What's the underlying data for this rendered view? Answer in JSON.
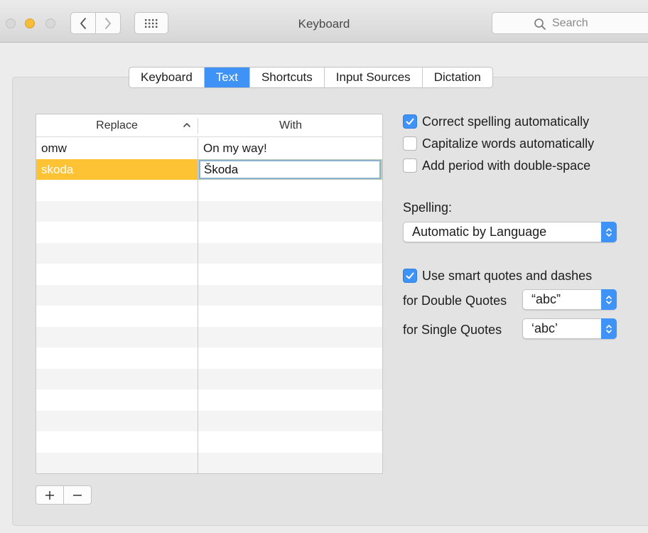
{
  "window": {
    "title": "Keyboard"
  },
  "toolbar": {
    "search_placeholder": "Search"
  },
  "tabs": [
    {
      "label": "Keyboard",
      "active": false
    },
    {
      "label": "Text",
      "active": true
    },
    {
      "label": "Shortcuts",
      "active": false
    },
    {
      "label": "Input Sources",
      "active": false
    },
    {
      "label": "Dictation",
      "active": false
    }
  ],
  "table": {
    "headers": {
      "replace": "Replace",
      "with": "With"
    },
    "rows": [
      {
        "replace": "omw",
        "with": "On my way!"
      },
      {
        "replace": "skoda",
        "with": "Škoda",
        "selected": true,
        "editing": true
      }
    ]
  },
  "options": {
    "correct_spelling": {
      "label": "Correct spelling automatically",
      "checked": true
    },
    "capitalize_words": {
      "label": "Capitalize words automatically",
      "checked": false
    },
    "add_period": {
      "label": "Add period with double-space",
      "checked": false
    },
    "spelling_label": "Spelling:",
    "spelling_value": "Automatic by Language",
    "smart_quotes": {
      "label": "Use smart quotes and dashes",
      "checked": true
    },
    "double_quotes_label": "for Double Quotes",
    "double_quotes_value": "“abc”",
    "single_quotes_label": "for Single Quotes",
    "single_quotes_value": "‘abc’"
  },
  "colors": {
    "accent": "#3f93f6",
    "selection": "#fec334"
  }
}
